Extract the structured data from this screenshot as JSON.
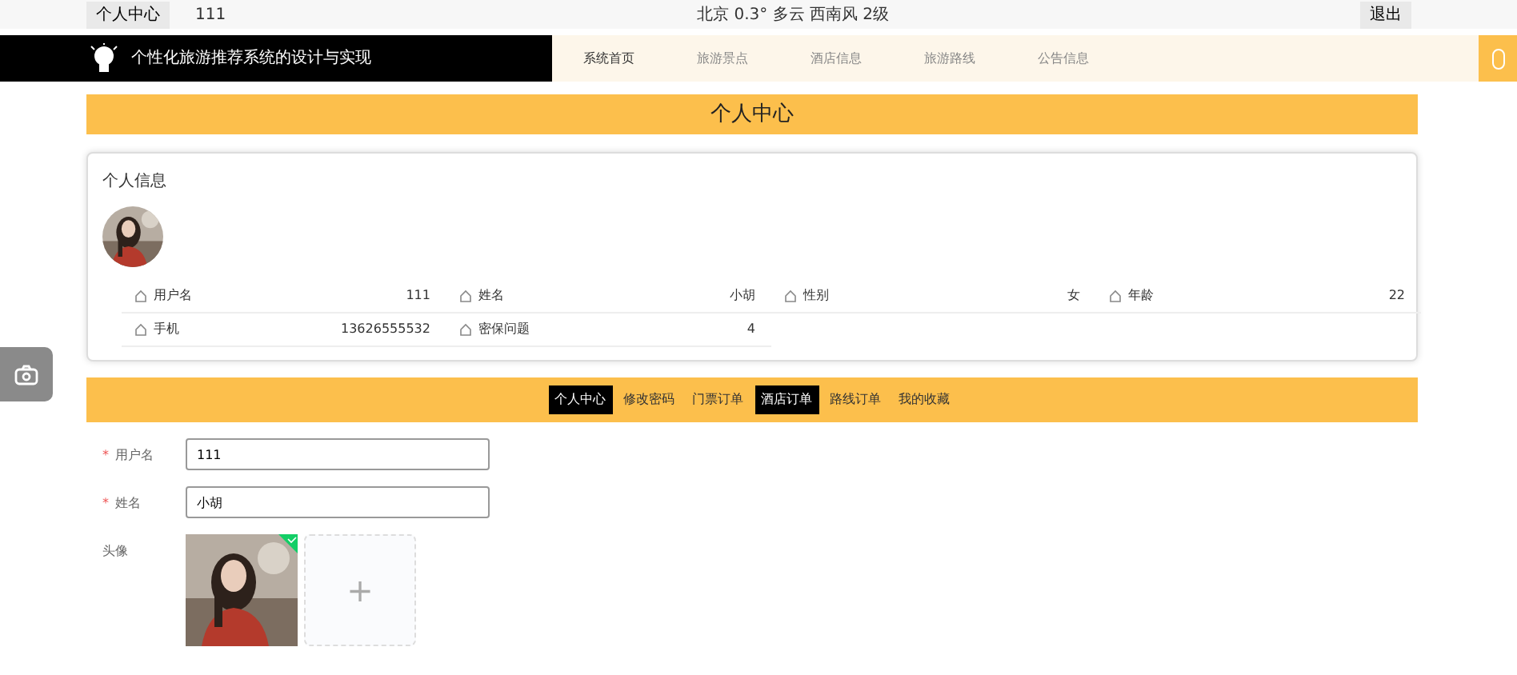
{
  "top_bar": {
    "user_button": "个人中心",
    "username": "111",
    "weather": "北京  0.3°  多云  西南风  2级",
    "logout": "退出"
  },
  "header": {
    "title": "个性化旅游推荐系统的设计与实现",
    "nav": [
      {
        "label": "系统首页",
        "selected": true
      },
      {
        "label": "旅游景点",
        "selected": false
      },
      {
        "label": "酒店信息",
        "selected": false
      },
      {
        "label": "旅游路线",
        "selected": false
      },
      {
        "label": "公告信息",
        "selected": false
      }
    ]
  },
  "page_title": "个人中心",
  "profile": {
    "heading": "个人信息",
    "fields": [
      {
        "label": "用户名",
        "value": "111"
      },
      {
        "label": "姓名",
        "value": "小胡"
      },
      {
        "label": "性别",
        "value": "女"
      },
      {
        "label": "年龄",
        "value": "22"
      },
      {
        "label": "手机",
        "value": "13626555532"
      },
      {
        "label": "密保问题",
        "value": "4"
      }
    ]
  },
  "tabs": [
    {
      "label": "个人中心",
      "selected": true
    },
    {
      "label": "修改密码",
      "selected": false
    },
    {
      "label": "门票订单",
      "selected": false
    },
    {
      "label": "酒店订单",
      "selected": true
    },
    {
      "label": "路线订单",
      "selected": false
    },
    {
      "label": "我的收藏",
      "selected": false
    }
  ],
  "form": {
    "fields": [
      {
        "required_mark": "*",
        "label": "用户名",
        "value": "111"
      },
      {
        "required_mark": "*",
        "label": "姓名",
        "value": "小胡"
      }
    ],
    "avatar_label": "头像",
    "upload_plus": "+"
  }
}
